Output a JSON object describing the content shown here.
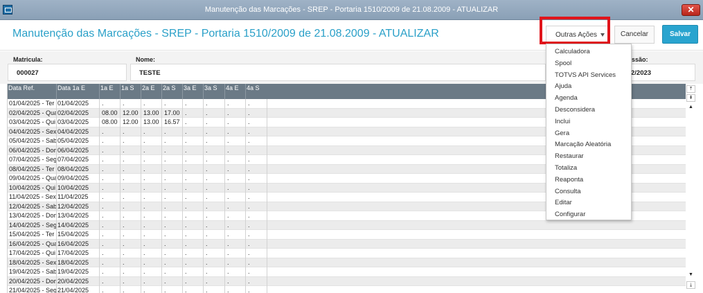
{
  "window": {
    "title": "Manutenção das Marcações - SREP - Portaria 1510/2009 de 21.08.2009 - ATUALIZAR",
    "close_label": "✕"
  },
  "header": {
    "title": "Manutenção das Marcações - SREP - Portaria 1510/2009 de 21.08.2009 - ATUALIZAR",
    "outras_acoes_label": "Outras Ações",
    "cancel_label": "Cancelar",
    "save_label": "Salvar"
  },
  "fields": {
    "matricula_label": "Matricula:",
    "matricula_value": "000027",
    "nome_label": "Nome:",
    "nome_value": "TESTE",
    "third_label": "ssão:",
    "third_value": "2/2023"
  },
  "menu": {
    "items": [
      "Calculadora",
      "Spool",
      "TOTVS API Services",
      "Ajuda",
      "Agenda",
      "Desconsidera",
      "Inclui",
      "Gera",
      "Marcação Aleatória",
      "Restaurar",
      "Totaliza",
      "Reaponta",
      "Consulta",
      "Editar",
      "Configurar"
    ]
  },
  "grid": {
    "columns": [
      "Data Ref.",
      "Data 1a E",
      "1a E",
      "1a S",
      "2a E",
      "2a S",
      "3a E",
      "3a S",
      "4a E",
      "4a S"
    ],
    "rows": [
      [
        "01/04/2025 - Ter",
        "01/04/2025",
        ".",
        ".",
        ".",
        ".",
        ".",
        ".",
        ".",
        "."
      ],
      [
        "02/04/2025 - Qua",
        "02/04/2025",
        "08.00",
        "12.00",
        "13.00",
        "17.00",
        ".",
        ".",
        ".",
        "."
      ],
      [
        "03/04/2025 - Qui",
        "03/04/2025",
        "08.00",
        "12.00",
        "13.00",
        "16.57",
        ".",
        ".",
        ".",
        "."
      ],
      [
        "04/04/2025 - Sex",
        "04/04/2025",
        ".",
        ".",
        ".",
        ".",
        ".",
        ".",
        ".",
        "."
      ],
      [
        "05/04/2025 - Sab",
        "05/04/2025",
        ".",
        ".",
        ".",
        ".",
        ".",
        ".",
        ".",
        "."
      ],
      [
        "06/04/2025 - Dom",
        "06/04/2025",
        ".",
        ".",
        ".",
        ".",
        ".",
        ".",
        ".",
        "."
      ],
      [
        "07/04/2025 - Seg",
        "07/04/2025",
        ".",
        ".",
        ".",
        ".",
        ".",
        ".",
        ".",
        "."
      ],
      [
        "08/04/2025 - Ter",
        "08/04/2025",
        ".",
        ".",
        ".",
        ".",
        ".",
        ".",
        ".",
        "."
      ],
      [
        "09/04/2025 - Qua",
        "09/04/2025",
        ".",
        ".",
        ".",
        ".",
        ".",
        ".",
        ".",
        "."
      ],
      [
        "10/04/2025 - Qui",
        "10/04/2025",
        ".",
        ".",
        ".",
        ".",
        ".",
        ".",
        ".",
        "."
      ],
      [
        "11/04/2025 - Sex",
        "11/04/2025",
        ".",
        ".",
        ".",
        ".",
        ".",
        ".",
        ".",
        "."
      ],
      [
        "12/04/2025 - Sab",
        "12/04/2025",
        ".",
        ".",
        ".",
        ".",
        ".",
        ".",
        ".",
        "."
      ],
      [
        "13/04/2025 - Dom",
        "13/04/2025",
        ".",
        ".",
        ".",
        ".",
        ".",
        ".",
        ".",
        "."
      ],
      [
        "14/04/2025 - Seg",
        "14/04/2025",
        ".",
        ".",
        ".",
        ".",
        ".",
        ".",
        ".",
        "."
      ],
      [
        "15/04/2025 - Ter",
        "15/04/2025",
        ".",
        ".",
        ".",
        ".",
        ".",
        ".",
        ".",
        "."
      ],
      [
        "16/04/2025 - Qua",
        "16/04/2025",
        ".",
        ".",
        ".",
        ".",
        ".",
        ".",
        ".",
        "."
      ],
      [
        "17/04/2025 - Qui",
        "17/04/2025",
        ".",
        ".",
        ".",
        ".",
        ".",
        ".",
        ".",
        "."
      ],
      [
        "18/04/2025 - Sex",
        "18/04/2025",
        ".",
        ".",
        ".",
        ".",
        ".",
        ".",
        ".",
        "."
      ],
      [
        "19/04/2025 - Sab",
        "19/04/2025",
        ".",
        ".",
        ".",
        ".",
        ".",
        ".",
        ".",
        "."
      ],
      [
        "20/04/2025 - Dom",
        "20/04/2025",
        ".",
        ".",
        ".",
        ".",
        ".",
        ".",
        ".",
        "."
      ],
      [
        "21/04/2025 - Seg",
        "21/04/2025",
        ".",
        ".",
        ".",
        ".",
        ".",
        ".",
        ".",
        "."
      ]
    ]
  },
  "scroll": {
    "top_label": "⤒",
    "page_up_label": "⇞",
    "up_label": "▲",
    "down_label": "▼",
    "bottom_label": "⤓"
  }
}
